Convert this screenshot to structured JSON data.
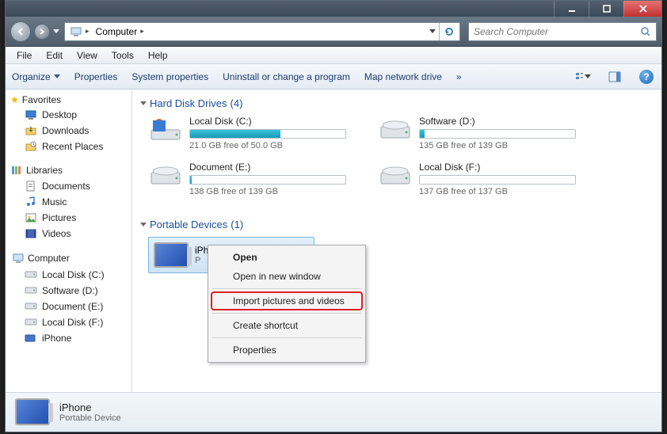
{
  "titlebar": {
    "buttons": [
      "minimize",
      "maximize",
      "close"
    ]
  },
  "nav": {
    "breadcrumb": [
      "Computer"
    ],
    "search_placeholder": "Search Computer"
  },
  "menubar": [
    "File",
    "Edit",
    "View",
    "Tools",
    "Help"
  ],
  "toolbar": {
    "organize": "Organize",
    "items": [
      "Properties",
      "System properties",
      "Uninstall or change a program",
      "Map network drive"
    ],
    "overflow": "»"
  },
  "sidebar": {
    "favorites": {
      "label": "Favorites",
      "items": [
        "Desktop",
        "Downloads",
        "Recent Places"
      ]
    },
    "libraries": {
      "label": "Libraries",
      "items": [
        "Documents",
        "Music",
        "Pictures",
        "Videos"
      ]
    },
    "computer": {
      "label": "Computer",
      "items": [
        "Local Disk (C:)",
        "Software (D:)",
        "Document (E:)",
        "Local Disk (F:)",
        "iPhone"
      ]
    }
  },
  "content": {
    "group_hdd": {
      "label": "Hard Disk Drives",
      "count": "(4)"
    },
    "drives": [
      {
        "name": "Local Disk (C:)",
        "free": "21.0 GB free of 50.0 GB",
        "used_pct": 58,
        "type": "os"
      },
      {
        "name": "Software (D:)",
        "free": "135 GB free of 139 GB",
        "used_pct": 3,
        "type": "hdd"
      },
      {
        "name": "Document (E:)",
        "free": "138 GB free of 139 GB",
        "used_pct": 1,
        "type": "hdd"
      },
      {
        "name": "Local Disk (F:)",
        "free": "137 GB free of 137 GB",
        "used_pct": 0,
        "type": "hdd"
      }
    ],
    "group_portable": {
      "label": "Portable Devices",
      "count": "(1)"
    },
    "device": {
      "name": "iPhone",
      "subtitle": "P"
    }
  },
  "context_menu": {
    "items": [
      {
        "label": "Open",
        "bold": true
      },
      {
        "label": "Open in new window"
      },
      {
        "sep": true
      },
      {
        "label": "Import pictures and videos",
        "highlight": true
      },
      {
        "sep": true
      },
      {
        "label": "Create shortcut"
      },
      {
        "sep": true
      },
      {
        "label": "Properties"
      }
    ]
  },
  "details": {
    "title": "iPhone",
    "subtitle": "Portable Device"
  }
}
